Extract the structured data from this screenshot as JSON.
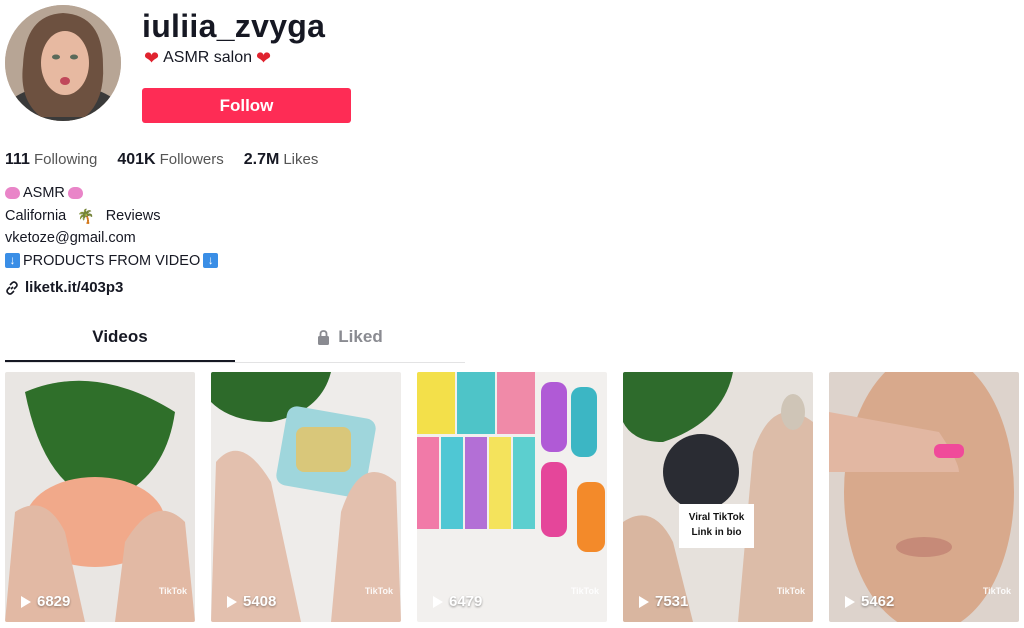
{
  "profile": {
    "username": "iuliia_zvyga",
    "subtitle": "ASMR salon",
    "follow_label": "Follow"
  },
  "stats": [
    {
      "value": "111",
      "label": "Following"
    },
    {
      "value": "401K",
      "label": "Followers"
    },
    {
      "value": "2.7M",
      "label": "Likes"
    }
  ],
  "bio": {
    "line1": "ASMR",
    "line2a": "California",
    "line2b": "Reviews",
    "line3": "vketoze@gmail.com",
    "line4": "PRODUCTS FROM VIDEO",
    "link": "liketk.it/403p3"
  },
  "tabs": {
    "videos": "Videos",
    "liked": "Liked"
  },
  "videos": [
    {
      "views": "6829",
      "watermark": "TikTok"
    },
    {
      "views": "5408",
      "watermark": "TikTok"
    },
    {
      "views": "6479",
      "watermark": "TikTok"
    },
    {
      "views": "7531",
      "watermark": "TikTok",
      "overlay_line1": "Viral TikTok",
      "overlay_line2": "Link in bio"
    },
    {
      "views": "5462",
      "watermark": "TikTok"
    }
  ],
  "colors": {
    "accent": "#fe2c55",
    "text": "#161823",
    "muted": "#8a8b91"
  }
}
